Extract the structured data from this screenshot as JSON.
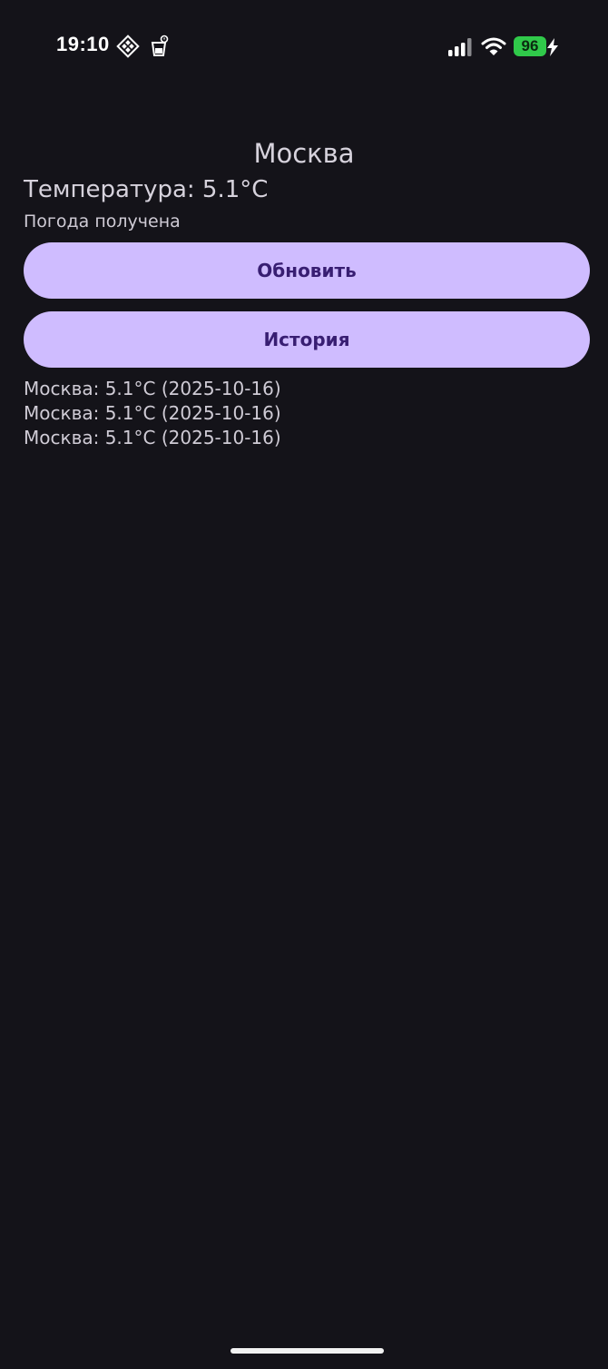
{
  "status_bar": {
    "time": "19:10",
    "battery": "96",
    "icons": [
      "diamond-grid-icon",
      "cup-alarm-icon",
      "signal-icon",
      "wifi-icon",
      "battery-icon",
      "charging-bolt-icon"
    ]
  },
  "weather": {
    "city": "Москва",
    "temperature": "Температура: 5.1°C",
    "status": "Погода получена"
  },
  "buttons": {
    "refresh_label": "Обновить",
    "history_label": "История"
  },
  "history": [
    "Москва: 5.1°C (2025-10-16)",
    "Москва: 5.1°C (2025-10-16)",
    "Москва: 5.1°C (2025-10-16)"
  ],
  "colors": {
    "background": "#141319",
    "button_bg": "#cfbcff",
    "button_text": "#381e72",
    "battery": "#30c94a"
  }
}
